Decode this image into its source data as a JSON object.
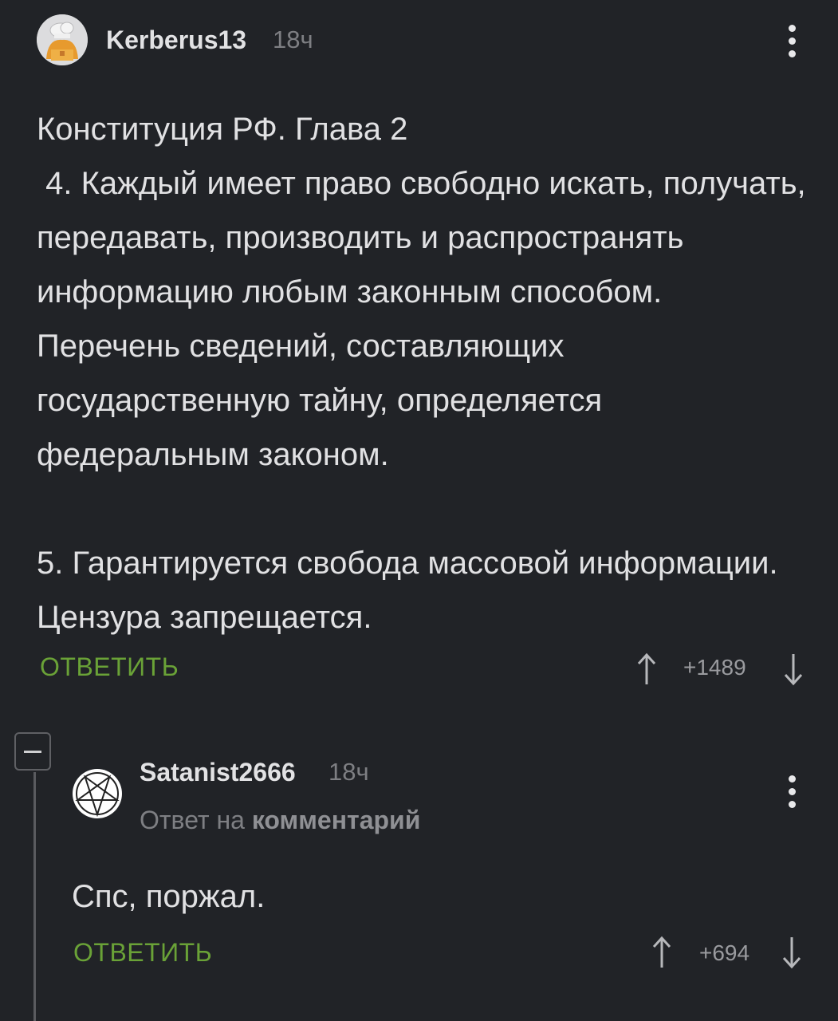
{
  "comment": {
    "author": "Kerberus13",
    "time": "18ч",
    "text": "Конституция РФ. Глава 2\n 4. Каждый имеет право свободно искать, получать, передавать, производить и распространять информацию любым законным способом. Перечень сведений, составляющих государственную тайну, определяется федеральным законом.\n\n5. Гарантируется свобода массовой информации. Цензура запрещается.",
    "reply_label": "ОТВЕТИТЬ",
    "rating": "+1489",
    "avatar_icon": "chef-avatar-icon",
    "menu_icon": "kebab-menu-icon"
  },
  "reply": {
    "collapse_icon": "minus-icon",
    "author": "Satanist2666",
    "time": "18ч",
    "reply_to_prefix": "Ответ на",
    "reply_to_link": "комментарий",
    "text": "Спс, поржал.",
    "reply_label": "ОТВЕТИТЬ",
    "rating": "+694",
    "avatar_icon": "pentagram-avatar-icon",
    "menu_icon": "kebab-menu-icon"
  },
  "colors": {
    "background": "#212327",
    "accent_green": "#6aa237",
    "text": "#e1e1e3",
    "muted": "#7e7f83"
  }
}
